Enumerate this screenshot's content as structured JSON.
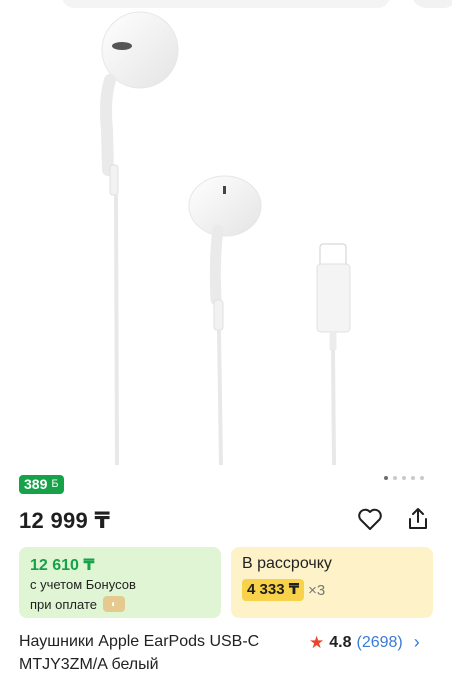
{
  "gallery": {
    "dots_total": 5,
    "active_index": 0
  },
  "product": {
    "bonus_badge": "389",
    "bonus_badge_icon": "Б",
    "price": "12 999 ₸",
    "title": "Наушники Apple EarPods USB-C MTJY3ZM/A белый",
    "rating": "4.8",
    "reviews": "(2698)"
  },
  "bonus_card": {
    "price": "12 610 ₸",
    "line1": "с учетом Бонусов",
    "line2": "при оплате"
  },
  "installment_card": {
    "title": "В рассрочку",
    "amount": "4 333 ₸",
    "times": "×3"
  },
  "colors": {
    "green": "#15a249",
    "installment_yellow": "#f7d24a",
    "star": "#e8452f",
    "link": "#3a7bd5"
  },
  "icons": {
    "favorite": "heart-icon",
    "share": "share-icon",
    "rating": "star-icon",
    "chevron": "chevron-right-icon",
    "coin": "kaspi-coin-icon"
  }
}
